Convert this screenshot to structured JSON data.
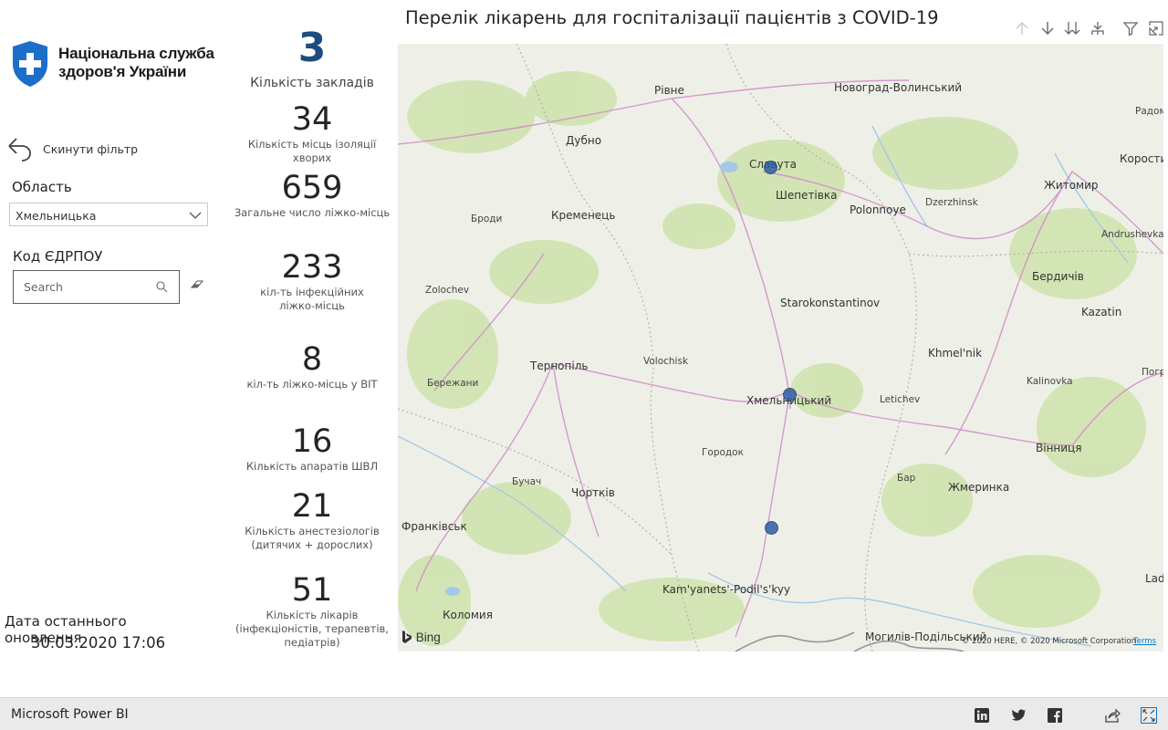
{
  "header": {
    "logo_line1": "Національна служба",
    "logo_line2": "здоров'я України",
    "title": "Перелік лікарень для госпіталізації пацієнтів з COVID-19"
  },
  "filters": {
    "reset_label": "Скинути фільтр",
    "oblast_label": "Область",
    "oblast_value": "Хмельницька",
    "edrpou_label": "Код ЄДРПОУ",
    "search_placeholder": "Search"
  },
  "kpis": [
    {
      "value": "3",
      "caption": "Кількість закладів"
    },
    {
      "value": "34",
      "caption": "Кількість місць ізоляції хворих"
    },
    {
      "value": "659",
      "caption": "Загальне число ліжко-місць"
    },
    {
      "value": "233",
      "caption": "кіл-ть інфекційних ліжко-місць"
    },
    {
      "value": "8",
      "caption": "кіл-ть ліжко-місць у ВІТ"
    },
    {
      "value": "16",
      "caption": "Кількість апаратів ШВЛ"
    },
    {
      "value": "21",
      "caption": "Кількість анестезіологів (дитячих + дорослих)"
    },
    {
      "value": "51",
      "caption": "Кількість лікарів (інфекціоністів, терапевтів, педіатрів)"
    }
  ],
  "update": {
    "label": "Дата останнього оновлення",
    "value": "30.03.2020 17:06"
  },
  "map": {
    "places": [
      {
        "name": "Рівне"
      },
      {
        "name": "Новоград-Волинський"
      },
      {
        "name": "Радом"
      },
      {
        "name": "Дубно"
      },
      {
        "name": "Славута"
      },
      {
        "name": "Коростиш"
      },
      {
        "name": "Шепетівка"
      },
      {
        "name": "Житомир"
      },
      {
        "name": "Броди"
      },
      {
        "name": "Кременець"
      },
      {
        "name": "Polonnoye"
      },
      {
        "name": "Dzerzhinsk"
      },
      {
        "name": "Andrushevka"
      },
      {
        "name": "Бердичів"
      },
      {
        "name": "Zolochev"
      },
      {
        "name": "Starokonstantinov"
      },
      {
        "name": "Kazatin"
      },
      {
        "name": "Khmel'nik"
      },
      {
        "name": "Тернопіль"
      },
      {
        "name": "Volochisk"
      },
      {
        "name": "Погр"
      },
      {
        "name": "Бережани"
      },
      {
        "name": "Kalinovka"
      },
      {
        "name": "Хмельницький"
      },
      {
        "name": "Letichev"
      },
      {
        "name": "Вінниця"
      },
      {
        "name": "Городок"
      },
      {
        "name": "Бучач"
      },
      {
        "name": "Бар"
      },
      {
        "name": "Чортків"
      },
      {
        "name": "Жмеринка"
      },
      {
        "name": "Франківськ"
      },
      {
        "name": "Kam'yanets'-Podil's'kyy"
      },
      {
        "name": "Lad"
      },
      {
        "name": "Коломия"
      },
      {
        "name": "Могилів-Подільський"
      }
    ],
    "bing_label": "Bing",
    "copyright": "© 2020 HERE, © 2020 Microsoft Corporation",
    "terms": "Terms"
  },
  "footer": {
    "brand": "Microsoft Power BI"
  }
}
